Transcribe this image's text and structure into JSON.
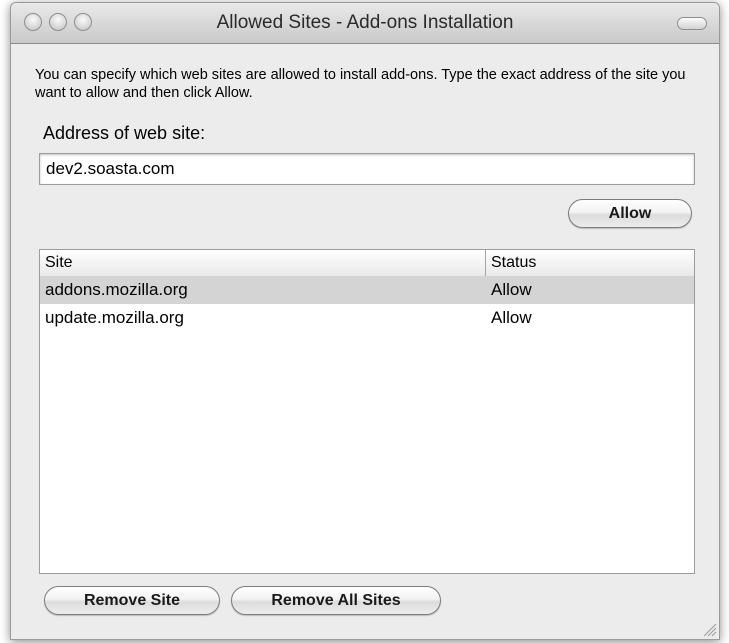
{
  "window": {
    "title": "Allowed Sites - Add-ons Installation"
  },
  "description": "You can specify which web sites are allowed to install add-ons. Type the exact address of the site you want to allow and then click Allow.",
  "address": {
    "label": "Address of web site:",
    "value": "dev2.soasta.com"
  },
  "buttons": {
    "allow": "Allow",
    "remove_site": "Remove Site",
    "remove_all_sites": "Remove All Sites"
  },
  "table": {
    "columns": [
      "Site",
      "Status"
    ],
    "rows": [
      {
        "site": "addons.mozilla.org",
        "status": "Allow",
        "selected": true
      },
      {
        "site": "update.mozilla.org",
        "status": "Allow",
        "selected": false
      }
    ]
  },
  "icons": {
    "traffic_lights": [
      "close-icon",
      "minimize-icon",
      "zoom-icon"
    ],
    "toolbar_toggle": "toolbar-toggle-icon",
    "resize": "resize-grip-icon"
  }
}
